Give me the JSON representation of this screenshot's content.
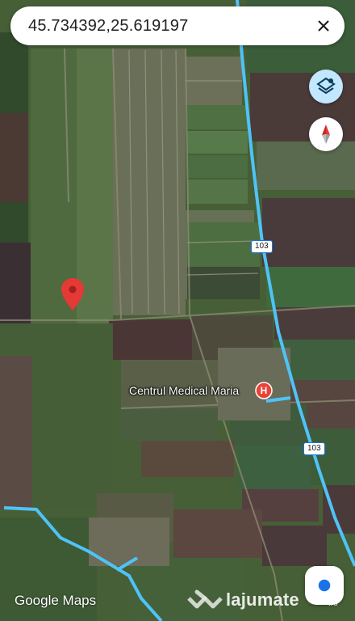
{
  "search": {
    "query": "45.734392,25.619197"
  },
  "map": {
    "poi_name": "Centrul Medical Maria",
    "poi_icon_letter": "H",
    "poi_icon_color": "#ea4335",
    "road_number_1": "103",
    "road_number_2": "103",
    "road_color": "#4fc3f7",
    "pin_color": "#e53935"
  },
  "controls": {
    "layers_icon": "layers-icon",
    "compass_icon": "compass-icon",
    "location_icon": "my-location-icon",
    "close_icon": "close-icon"
  },
  "attribution": {
    "google_maps": "Google Maps"
  },
  "watermark": {
    "brand": "lajumate",
    "suffix": ".ro"
  }
}
